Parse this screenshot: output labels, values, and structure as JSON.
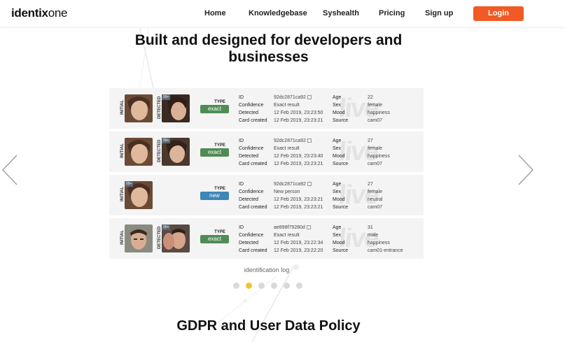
{
  "header": {
    "logo_bold": "identix",
    "logo_light": "one",
    "nav": [
      "Home",
      "Knowledgebase",
      "Syshealth",
      "Pricing",
      "Sign up"
    ],
    "login_label": "Login"
  },
  "hero": {
    "title": "Built and designed for developers and businesses"
  },
  "log": {
    "watermark": "live",
    "initial_label": "INITIAL",
    "detected_label": "DETECTED",
    "type_label": "TYPE",
    "field_labels": [
      "ID",
      "Confidence",
      "Detected",
      "Card created"
    ],
    "attr_labels": [
      "Age",
      "Sex",
      "Mood",
      "Source"
    ],
    "rows": [
      {
        "badge": "99+",
        "type": "exact",
        "id": "92dc2871ca92",
        "confidence": "Exact result",
        "detected": "12 Feb 2019, 23:23:50",
        "card_created": "12 Feb 2019, 23:23:21",
        "age": "22",
        "sex": "female",
        "mood": "happiness",
        "source": "cam07"
      },
      {
        "badge": "99+",
        "type": "exact",
        "id": "92dc2871ca92",
        "confidence": "Exact result",
        "detected": "12 Feb 2019, 23:23:40",
        "card_created": "12 Feb 2019, 23:23:21",
        "age": "27",
        "sex": "female",
        "mood": "happiness",
        "source": "cam07"
      },
      {
        "badge": "99+",
        "type": "new",
        "id": "92dc2871ca92",
        "confidence": "New person",
        "detected": "12 Feb 2019, 23:23:21",
        "card_created": "12 Feb 2019, 23:23:21",
        "age": "27",
        "sex": "female",
        "mood": "neutral",
        "source": "cam07"
      },
      {
        "badge": "99+",
        "type": "exact",
        "id": "ae898f79280d",
        "confidence": "Exact result",
        "detected": "12 Feb 2019, 23:22:34",
        "card_created": "12 Feb 2019, 23:22:20",
        "age": "31",
        "sex": "male",
        "mood": "happiness",
        "source": "cam01-entrance"
      }
    ],
    "caption": "identification log"
  },
  "carousel": {
    "slides": 6,
    "active": 2
  },
  "gdpr": {
    "title": "GDPR and User Data Policy"
  },
  "colors": {
    "login": "#f15a24",
    "exact": "#4f8c55",
    "new": "#3e86b5",
    "active_dot": "#f2c230"
  }
}
